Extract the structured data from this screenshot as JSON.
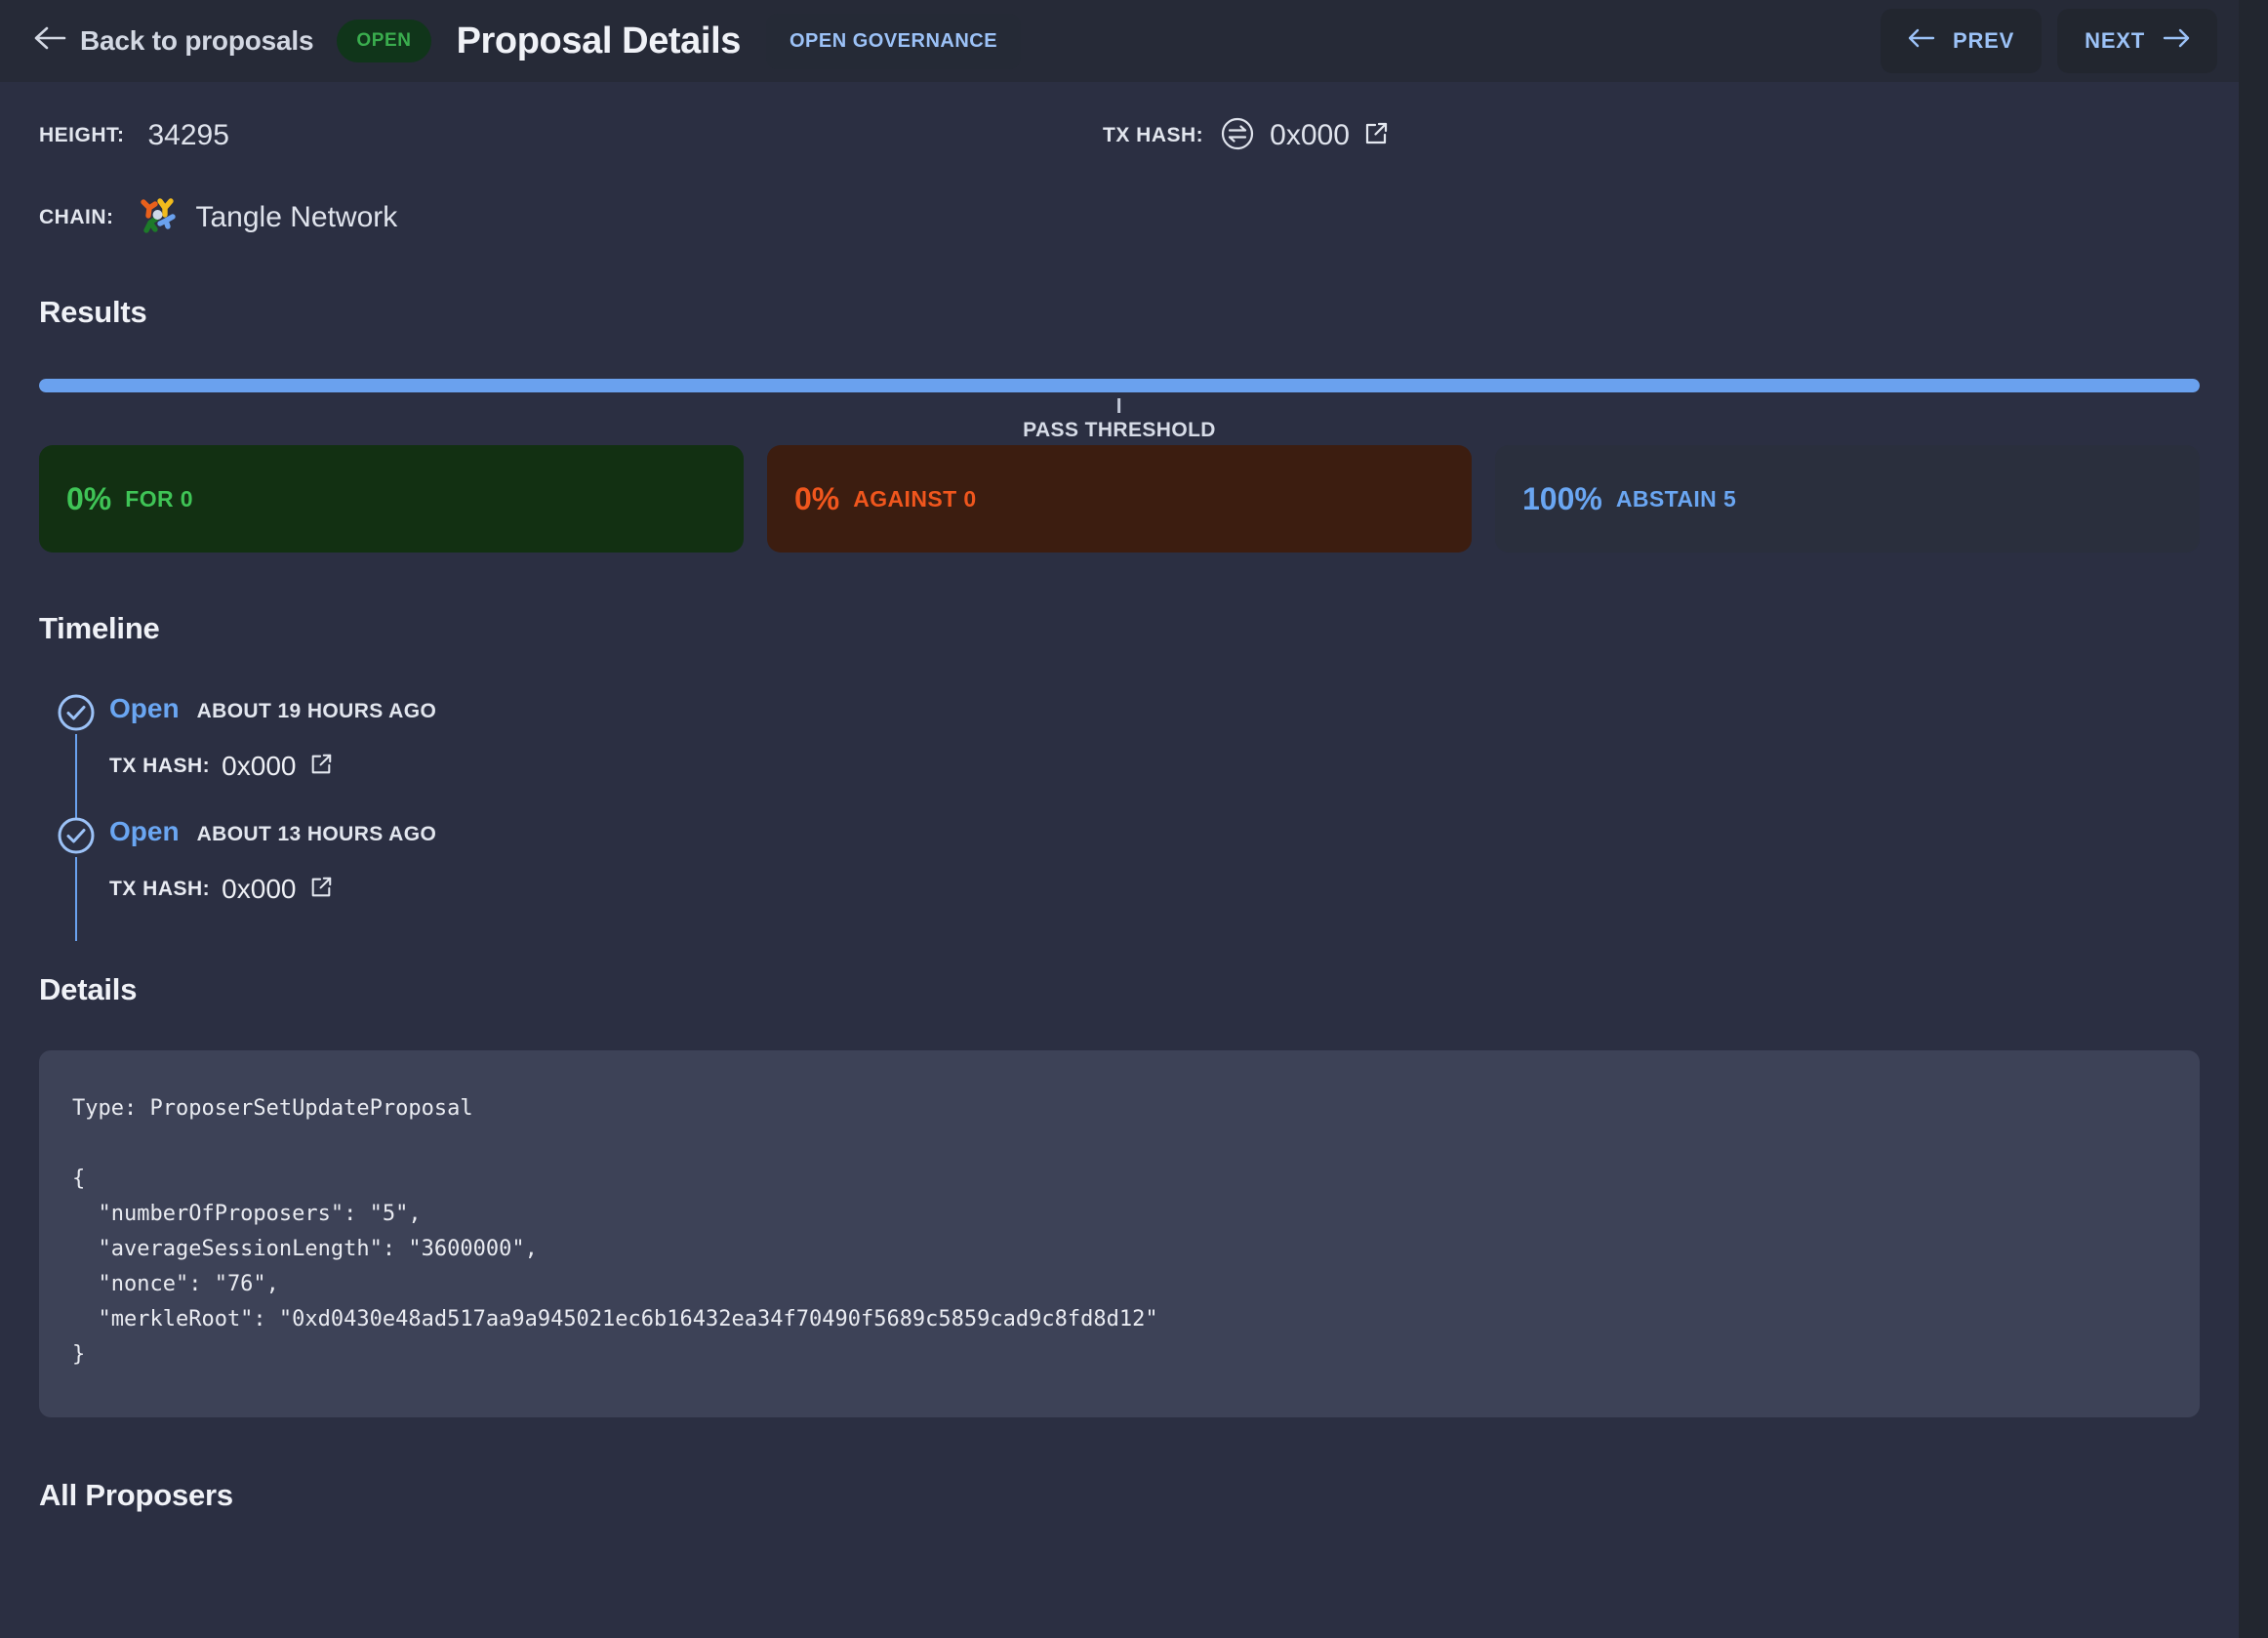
{
  "header": {
    "back_label": "Back to proposals",
    "status_pill": "OPEN",
    "title": "Proposal Details",
    "governance_badge": "OPEN GOVERNANCE",
    "prev_label": "PREV",
    "next_label": "NEXT"
  },
  "meta": {
    "height_label": "HEIGHT:",
    "height_value": "34295",
    "tx_hash_label": "TX HASH:",
    "tx_hash_value": "0x000",
    "chain_label": "CHAIN:",
    "chain_name": "Tangle Network"
  },
  "results": {
    "heading": "Results",
    "progress_percent": 100,
    "threshold_percent": 50,
    "threshold_label": "PASS THRESHOLD",
    "cards": [
      {
        "percent": "0%",
        "label": "FOR 0",
        "kind": "for"
      },
      {
        "percent": "0%",
        "label": "AGAINST 0",
        "kind": "against"
      },
      {
        "percent": "100%",
        "label": "ABSTAIN 5",
        "kind": "abstain"
      }
    ]
  },
  "timeline": {
    "heading": "Timeline",
    "items": [
      {
        "status": "Open",
        "time": "ABOUT 19 HOURS AGO",
        "tx_label": "TX HASH:",
        "tx_value": "0x000"
      },
      {
        "status": "Open",
        "time": "ABOUT 13 HOURS AGO",
        "tx_label": "TX HASH:",
        "tx_value": "0x000"
      }
    ]
  },
  "details": {
    "heading": "Details",
    "code": "Type: ProposerSetUpdateProposal\n\n{\n  \"numberOfProposers\": \"5\",\n  \"averageSessionLength\": \"3600000\",\n  \"nonce\": \"76\",\n  \"merkleRoot\": \"0xd0430e48ad517aa9a945021ec6b16432ea34f70490f5689c5859cad9c8fd8d12\"\n}"
  },
  "proposers": {
    "heading": "All Proposers"
  },
  "colors": {
    "page_bg": "#2b2f42",
    "header_bg": "#262a37",
    "accent_blue": "#6aa6f2",
    "for_green": "#3fc456",
    "against_orange": "#f0561d",
    "open_green": "#3aad4e"
  }
}
